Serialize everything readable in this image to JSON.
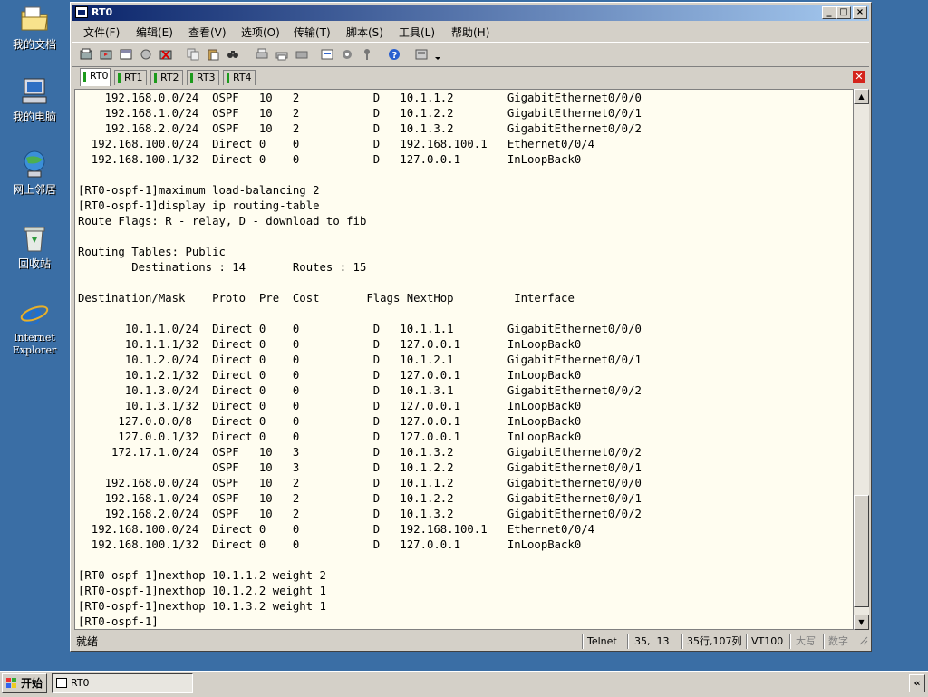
{
  "desktop": {
    "icons": [
      {
        "label": "我的文档"
      },
      {
        "label": "我的电脑"
      },
      {
        "label": "网上邻居"
      },
      {
        "label": "回收站"
      },
      {
        "label_line1": "Internet",
        "label_line2": "Explorer"
      }
    ]
  },
  "window": {
    "title": "RT0",
    "buttons": {
      "minimize": "_",
      "maximize": "□",
      "close": "×"
    }
  },
  "menu": [
    "文件(F)",
    "编辑(E)",
    "查看(V)",
    "选项(O)",
    "传输(T)",
    "脚本(S)",
    "工具(L)",
    "帮助(H)"
  ],
  "tabs": [
    "RT0",
    "RT1",
    "RT2",
    "RT3",
    "RT4"
  ],
  "terminal": {
    "lines": [
      "    192.168.0.0/24  OSPF   10   2           D   10.1.1.2        GigabitEthernet0/0/0",
      "    192.168.1.0/24  OSPF   10   2           D   10.1.2.2        GigabitEthernet0/0/1",
      "    192.168.2.0/24  OSPF   10   2           D   10.1.3.2        GigabitEthernet0/0/2",
      "  192.168.100.0/24  Direct 0    0           D   192.168.100.1   Ethernet0/0/4",
      "  192.168.100.1/32  Direct 0    0           D   127.0.0.1       InLoopBack0",
      "",
      "[RT0-ospf-1]maximum load-balancing 2",
      "[RT0-ospf-1]display ip routing-table",
      "Route Flags: R - relay, D - download to fib",
      "------------------------------------------------------------------------------",
      "Routing Tables: Public",
      "        Destinations : 14       Routes : 15",
      "",
      "Destination/Mask    Proto  Pre  Cost       Flags NextHop         Interface",
      "",
      "       10.1.1.0/24  Direct 0    0           D   10.1.1.1        GigabitEthernet0/0/0",
      "       10.1.1.1/32  Direct 0    0           D   127.0.0.1       InLoopBack0",
      "       10.1.2.0/24  Direct 0    0           D   10.1.2.1        GigabitEthernet0/0/1",
      "       10.1.2.1/32  Direct 0    0           D   127.0.0.1       InLoopBack0",
      "       10.1.3.0/24  Direct 0    0           D   10.1.3.1        GigabitEthernet0/0/2",
      "       10.1.3.1/32  Direct 0    0           D   127.0.0.1       InLoopBack0",
      "      127.0.0.0/8   Direct 0    0           D   127.0.0.1       InLoopBack0",
      "      127.0.0.1/32  Direct 0    0           D   127.0.0.1       InLoopBack0",
      "     172.17.1.0/24  OSPF   10   3           D   10.1.3.2        GigabitEthernet0/0/2",
      "                    OSPF   10   3           D   10.1.2.2        GigabitEthernet0/0/1",
      "    192.168.0.0/24  OSPF   10   2           D   10.1.1.2        GigabitEthernet0/0/0",
      "    192.168.1.0/24  OSPF   10   2           D   10.1.2.2        GigabitEthernet0/0/1",
      "    192.168.2.0/24  OSPF   10   2           D   10.1.3.2        GigabitEthernet0/0/2",
      "  192.168.100.0/24  Direct 0    0           D   192.168.100.1   Ethernet0/0/4",
      "  192.168.100.1/32  Direct 0    0           D   127.0.0.1       InLoopBack0",
      "",
      "[RT0-ospf-1]nexthop 10.1.1.2 weight 2",
      "[RT0-ospf-1]nexthop 10.1.2.2 weight 1",
      "[RT0-ospf-1]nexthop 10.1.3.2 weight 1",
      "[RT0-ospf-1]"
    ]
  },
  "status": {
    "ready": "就绪",
    "protocol": "Telnet",
    "cursor": "35,  13",
    "rowcol": "35行,107列",
    "term_type": "VT100",
    "caps": "大写",
    "num": "数字"
  },
  "taskbar": {
    "start": "开始",
    "task_label": "RT0",
    "tray_arrow": "«"
  },
  "colors": {
    "desktop": "#3a6ea5",
    "titlebar_start": "#0a246a",
    "terminal_bg": "#fffdf0",
    "tab_close": "#d4241c"
  }
}
